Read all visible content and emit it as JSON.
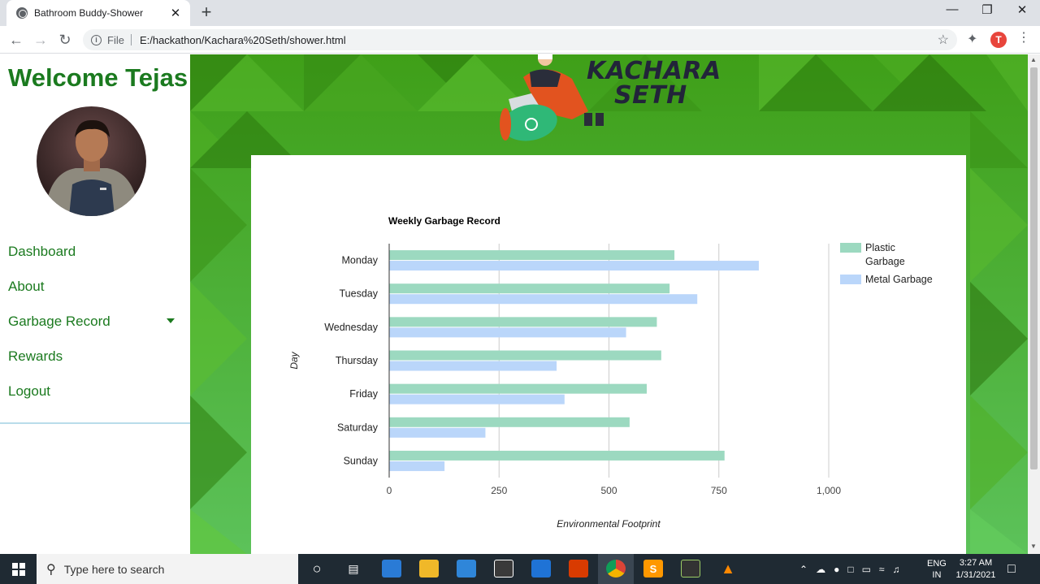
{
  "browser": {
    "tab_title": "Bathroom Buddy-Shower",
    "tab_close": "✕",
    "new_tab": "+",
    "file_label": "File",
    "url": "E:/hackathon/Kachara%20Seth/shower.html",
    "profile_initial": "T"
  },
  "sidebar": {
    "welcome": "Welcome Tejas",
    "nav": [
      {
        "label": "Dashboard"
      },
      {
        "label": "About"
      },
      {
        "label": "Garbage Record"
      },
      {
        "label": "Rewards"
      },
      {
        "label": "Logout"
      }
    ]
  },
  "header": {
    "logo_line1": "KACHARA",
    "logo_line2": "SETH"
  },
  "chart_data": {
    "type": "bar",
    "orientation": "horizontal",
    "title": "Weekly Garbage Record",
    "xlabel": "Environmental Footprint",
    "ylabel": "Day",
    "categories": [
      "Monday",
      "Tuesday",
      "Wednesday",
      "Thursday",
      "Friday",
      "Saturday",
      "Sunday"
    ],
    "series": [
      {
        "name": "Plastic Garbage",
        "legend_lines": [
          "Plastic",
          "Garbage"
        ],
        "color": "#9cd9c0",
        "values": [
          648,
          637,
          608,
          618,
          585,
          546,
          762
        ]
      },
      {
        "name": "Metal Garbage",
        "legend_lines": [
          "Metal Garbage"
        ],
        "color": "#bad6fa",
        "values": [
          840,
          700,
          538,
          380,
          398,
          218,
          125
        ]
      }
    ],
    "xlim": [
      0,
      1000
    ],
    "xticks": [
      0,
      250,
      500,
      750,
      1000
    ],
    "xtick_labels": [
      "0",
      "250",
      "500",
      "750",
      "1,000"
    ],
    "grid": true,
    "legend_position": "right"
  },
  "taskbar": {
    "search_placeholder": "Type here to search",
    "lang_top": "ENG",
    "lang_bottom": "IN",
    "time": "3:27 AM",
    "date": "1/31/2021"
  }
}
